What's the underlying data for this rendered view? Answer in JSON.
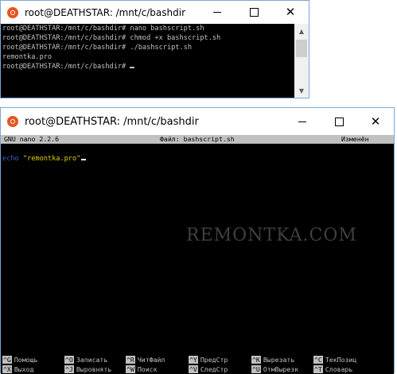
{
  "window1": {
    "title": "root@DEATHSTAR: /mnt/c/bashdir",
    "lines": [
      "root@DEATHSTAR:/mnt/c/bashdir# nano bashscript.sh",
      "root@DEATHSTAR:/mnt/c/bashdir# chmod +x bashscript.sh",
      "root@DEATHSTAR:/mnt/c/bashdir# ./bashscript.sh",
      "remontka.pro",
      "root@DEATHSTAR:/mnt/c/bashdir# "
    ]
  },
  "window2": {
    "title": "root@DEATHSTAR: /mnt/c/bashdir",
    "nano_header": {
      "version": "GNU nano 2.2.6",
      "file": "Файл: bashscript.sh",
      "status": "Изменён"
    },
    "editor": {
      "keyword": "echo",
      "string": "\"remontka.pro\""
    },
    "shortcuts_row1": [
      {
        "key": "^G",
        "label": "Помощь"
      },
      {
        "key": "^O",
        "label": "Записать"
      },
      {
        "key": "^R",
        "label": "ЧитФайл"
      },
      {
        "key": "^Y",
        "label": "ПредСтр"
      },
      {
        "key": "^K",
        "label": "Вырезать"
      },
      {
        "key": "^C",
        "label": "ТекПозиц"
      }
    ],
    "shortcuts_row2": [
      {
        "key": "^X",
        "label": "Выход"
      },
      {
        "key": "^J",
        "label": "Выровнять"
      },
      {
        "key": "^W",
        "label": "Поиск"
      },
      {
        "key": "^V",
        "label": "СледСтр"
      },
      {
        "key": "^U",
        "label": "ОтмВырезк"
      },
      {
        "key": "^T",
        "label": "Словарь"
      }
    ]
  },
  "window_controls": {
    "minimize": "minimize",
    "maximize": "maximize",
    "close": "✕"
  },
  "watermark": "REMONTKA.COM",
  "colors": {
    "terminal_bg": "#000000",
    "terminal_fg": "#c0c0c0",
    "nano_bar_bg": "#c0c0c0",
    "keyword": "#3b5fc0",
    "string": "#e0d000",
    "ubuntu_orange": "#e95420"
  }
}
